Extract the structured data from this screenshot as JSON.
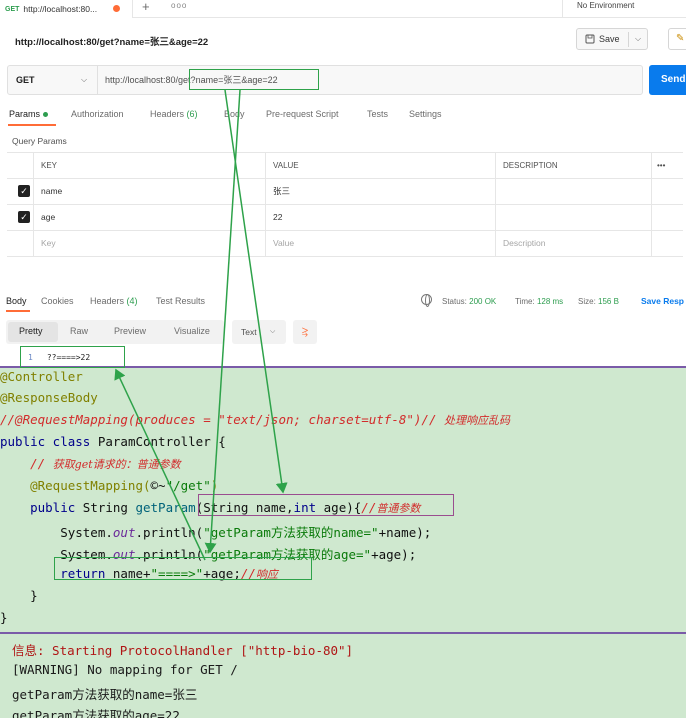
{
  "tab": {
    "method": "GET",
    "title": "http://localhost:80..."
  },
  "environment": "No Environment",
  "request": {
    "title": "http://localhost:80/get?name=张三&age=22",
    "save_label": "Save",
    "method": "GET",
    "url_base": "http://localhost:80/",
    "url_path": "get?name=张三&age=22",
    "send_label": "Send"
  },
  "request_tabs": [
    {
      "label": "Params",
      "count": ""
    },
    {
      "label": "Authorization",
      "count": ""
    },
    {
      "label": "Headers",
      "count": "(6)"
    },
    {
      "label": "Body",
      "count": ""
    },
    {
      "label": "Pre-request Script",
      "count": ""
    },
    {
      "label": "Tests",
      "count": ""
    },
    {
      "label": "Settings",
      "count": ""
    }
  ],
  "query_params_label": "Query Params",
  "params_table": {
    "headers": {
      "key": "KEY",
      "value": "VALUE",
      "description": "DESCRIPTION",
      "more": "•••"
    },
    "rows": [
      {
        "key": "name",
        "value": "张三"
      },
      {
        "key": "age",
        "value": "22"
      }
    ],
    "placeholder": {
      "key": "Key",
      "value": "Value",
      "description": "Description"
    }
  },
  "response_tabs": [
    {
      "label": "Body",
      "count": ""
    },
    {
      "label": "Cookies",
      "count": ""
    },
    {
      "label": "Headers",
      "count": "(4)"
    },
    {
      "label": "Test Results",
      "count": ""
    }
  ],
  "response_status": {
    "status_label": "Status:",
    "status_value": "200 OK",
    "time_label": "Time:",
    "time_value": "128 ms",
    "size_label": "Size:",
    "size_value": "156 B",
    "save_response": "Save Resp"
  },
  "format_tabs": [
    "Pretty",
    "Raw",
    "Preview",
    "Visualize"
  ],
  "text_format": "Text",
  "response_body": {
    "line_no": "1",
    "text": "??====>22"
  },
  "code": {
    "l1": "@Controller",
    "l2": "@ResponseBody",
    "l3": "//@RequestMapping(produces = \"text/json; charset=utf-8\")// ",
    "l3_cn": "处理响应乱码",
    "l4_kw": "public class ",
    "l4_rest": "ParamController {",
    "l5": "    // ",
    "l5_cn": "获取get请求的：普通参数",
    "l6_ann": "    @RequestMapping(",
    "l6_mid": "©~",
    "l6_str": "\"/get\"",
    "l6_end": ")",
    "l7_kw": "    public ",
    "l7_type": "String ",
    "l7_meth": "getParam",
    "l7_params": "(String name,",
    "l7_kw2": "int ",
    "l7_age": "age){",
    "l7_cm": "//",
    "l7_cn": "普通参数",
    "l8_a": "        System.",
    "l8_fld": "out",
    "l8_b": ".println(",
    "l8_str": "\"getParam方法获取的name=\"",
    "l8_c": "+name);",
    "l9_a": "        System.",
    "l9_fld": "out",
    "l9_b": ".println(",
    "l9_str": "\"getParam方法获取的age=\"",
    "l9_c": "+age);",
    "l10_kw": "        return ",
    "l10_a": "name+",
    "l10_str": "\"====>\"",
    "l10_b": "+age;",
    "l10_cm": "//",
    "l10_cn": "响应",
    "l11": "    }",
    "l12": "}"
  },
  "console": [
    "信息: Starting ProtocolHandler [\"http-bio-80\"]",
    "[WARNING] No mapping for GET /",
    "getParam方法获取的name=张三",
    "getParam方法获取的age=22"
  ]
}
